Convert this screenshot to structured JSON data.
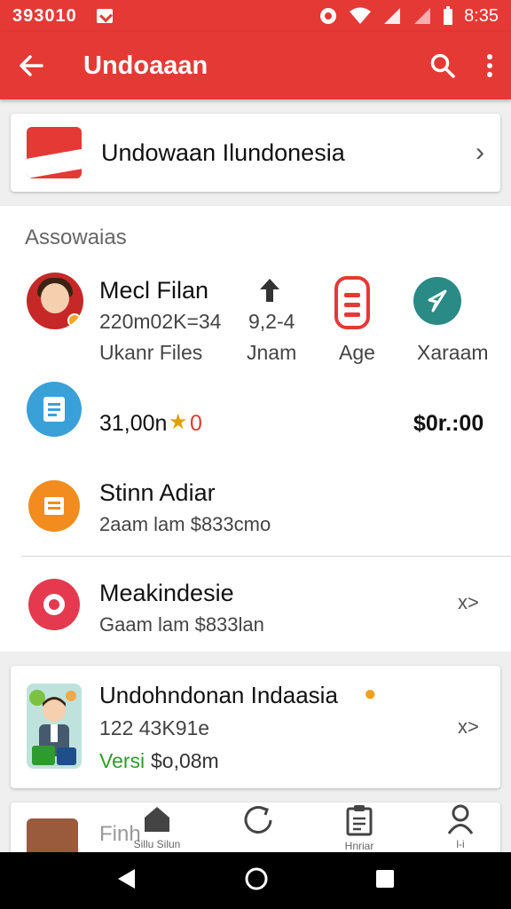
{
  "status_bar": {
    "carrier": "393010",
    "time": "8:35"
  },
  "app_bar": {
    "title": "Undoaaan"
  },
  "top_card": {
    "name": "Undowaan Ilundonesia"
  },
  "main": {
    "section_title": "Assowaias",
    "profile": {
      "name": "Mecl Filan",
      "stats": "220m02K=34",
      "label": "Ukanr Files"
    },
    "quick_actions": [
      {
        "value": "9,2-4",
        "label": "Jnam"
      },
      {
        "value": "",
        "label": "Age"
      },
      {
        "value": "",
        "label": "Xaraam"
      }
    ],
    "balance": {
      "left_value": "31,00n",
      "left_badge": "0",
      "right_value": "$0r.:00"
    },
    "items": [
      {
        "title": "Stinn Adiar",
        "subtitle": "2aam lam $833cmo"
      },
      {
        "title": "Meakindesie",
        "subtitle": "Gaam lam $833lan",
        "arrow": "x>"
      }
    ]
  },
  "app_card": {
    "title": "Undohndonan Indaasia",
    "stats": "122 43K91e",
    "version_label": "Versi",
    "version_value": "$o,08m",
    "arrow": "x>"
  },
  "partial_card": {
    "title": "Finh"
  },
  "bottom_nav": [
    {
      "label": "Sillu Silun"
    },
    {
      "label": ""
    },
    {
      "label": "Hnriar"
    },
    {
      "label": "l-i"
    }
  ],
  "colors": {
    "primary": "#e53935",
    "accent_green": "#2e9b2e",
    "teal": "#2a8a86",
    "orange": "#f28c1e",
    "blue": "#3aa0d8"
  }
}
